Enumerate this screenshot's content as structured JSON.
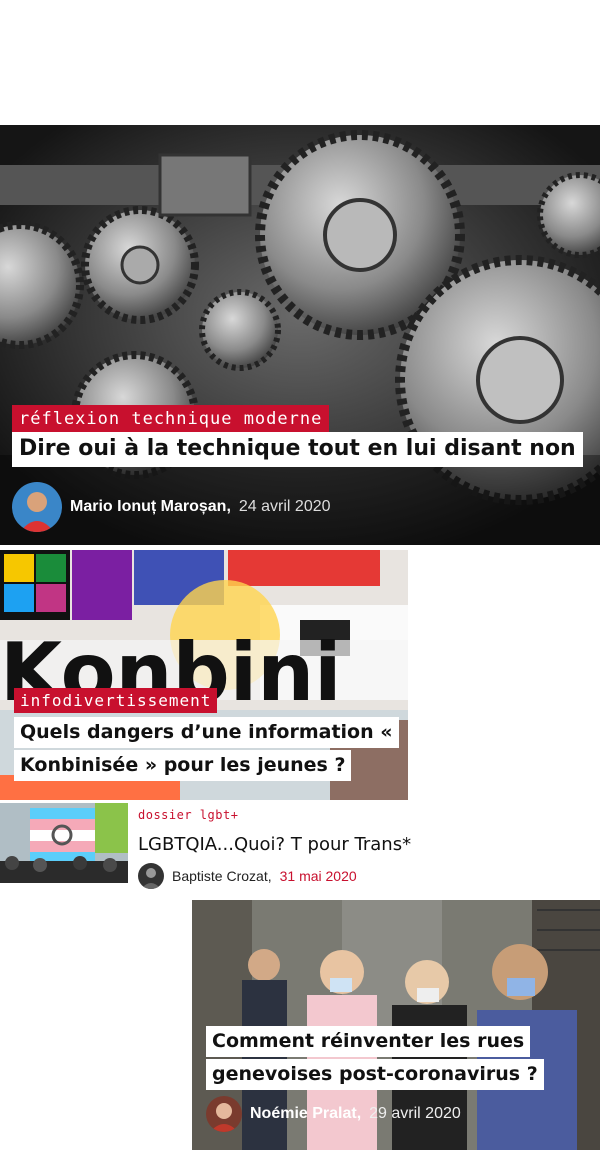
{
  "articles": [
    {
      "category": "réflexion technique moderne",
      "title": "Dire oui à la technique tout en lui disant non",
      "author": "Mario Ionuț Maroșan,",
      "date": "24 avril 2020",
      "image_icon": "gears-photo"
    },
    {
      "category": "infodivertissement",
      "title_lines": [
        "Quels dangers d’une information «",
        "Konbinisée » pour les jeunes ?"
      ],
      "image_icon": "konbini-collage"
    },
    {
      "category": "dossier lgbt+",
      "title": "LGBTQIA...Quoi? T pour Trans*",
      "author": "Baptiste Crozat,",
      "date": "31 mai 2020",
      "image_icon": "trans-flag-crowd"
    },
    {
      "title_lines": [
        "Comment réinventer les rues",
        "genevoises post-coronavirus ?"
      ],
      "author": "Noémie Pralat,",
      "date": "29 avril 2020",
      "image_icon": "masked-people-street"
    }
  ],
  "colors": {
    "accent": "#c8102e",
    "title_bg": "#ffffff"
  }
}
